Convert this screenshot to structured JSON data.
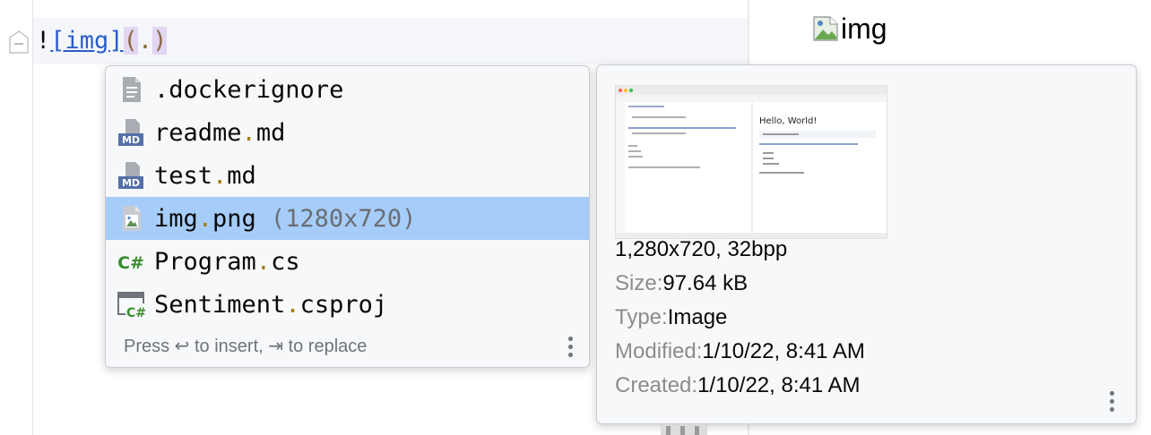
{
  "editor": {
    "code": {
      "excl": "!",
      "link_text": "[img]",
      "open_paren": "(",
      "dot": ".",
      "close_paren": ")"
    }
  },
  "preview": {
    "alt_text": "img",
    "broken_image_icon": "broken-image-icon"
  },
  "completion": {
    "items": [
      {
        "icon": "text-file-icon",
        "name": ".dockerignore",
        "ext": "",
        "hint": ""
      },
      {
        "icon": "markdown-file-icon",
        "name": "readme",
        "ext": "md",
        "hint": ""
      },
      {
        "icon": "markdown-file-icon",
        "name": "test",
        "ext": "md",
        "hint": ""
      },
      {
        "icon": "image-file-icon",
        "name": "img",
        "ext": "png",
        "hint": "(1280x720)",
        "selected": true
      },
      {
        "icon": "csharp-file-icon",
        "name": "Program",
        "ext": "cs",
        "hint": ""
      },
      {
        "icon": "csproj-file-icon",
        "name": "Sentiment",
        "ext": "csproj",
        "hint": ""
      }
    ],
    "footer": "Press ↩ to insert, ⇥ to replace",
    "more_icon": "kebab-menu-icon"
  },
  "doc": {
    "dimensions": "1,280x720, 32bpp",
    "size_label": "Size:",
    "size_value": "97.64 kB",
    "type_label": "Type:",
    "type_value": "Image",
    "modified_label": "Modified:",
    "modified_value": "1/10/22, 8:41 AM",
    "created_label": "Created:",
    "created_value": "1/10/22, 8:41 AM",
    "thumbnail_heading": "Hello, World!",
    "more_icon": "kebab-menu-icon"
  },
  "colors": {
    "selection": "#a6cdf9",
    "link": "#2a5dc8",
    "paren_bg": "#e3d6f3",
    "ext_dot": "#a47c0d"
  }
}
